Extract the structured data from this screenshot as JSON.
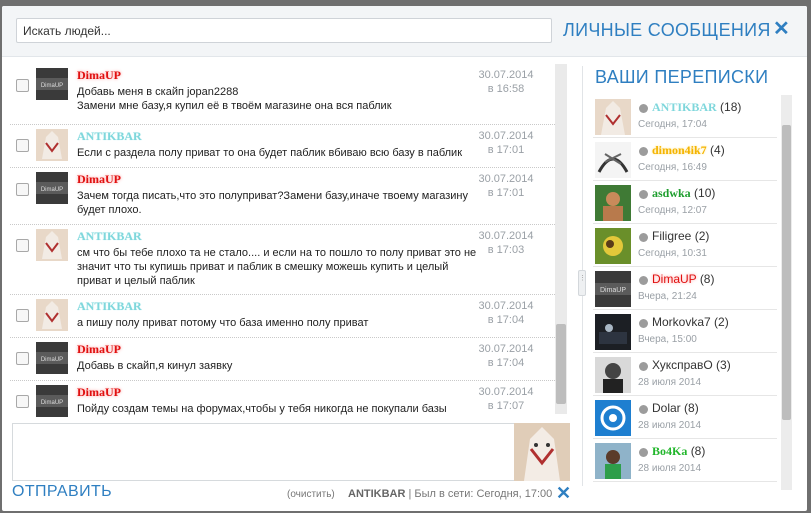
{
  "header": {
    "search_placeholder": "Искать людей...",
    "title": "ЛИЧНЫЕ СООБЩЕНИЯ",
    "close_glyph": "✕"
  },
  "messages": [
    {
      "nick": "DimaUP",
      "text": "Добавь меня в скайп jopan2288\nЗамени мне базу,я купил её в твоём магазине она вся паблик",
      "date": "30.07.2014",
      "time": "в 16:58"
    },
    {
      "nick": "ANTIKBAR",
      "text": "Если с раздела полу приват то она будет паблик вбиваю всю базу в паблик",
      "date": "30.07.2014",
      "time": "в 17:01"
    },
    {
      "nick": "DimaUP",
      "text": "Зачем тогда писать,что это полуприват?Замени базу,иначе твоему магазину будет плохо.",
      "date": "30.07.2014",
      "time": "в 17:01"
    },
    {
      "nick": "ANTIKBAR",
      "text": "см что бы тебе плохо та не стало.... и если на то пошло то полу приват это не значит что ты купишь приват и паблик в смешку можешь купить и целый приват и целый паблик",
      "date": "30.07.2014",
      "time": "в 17:03"
    },
    {
      "nick": "ANTIKBAR",
      "text": "а пишу полу приват потому что база именно полу приват",
      "date": "30.07.2014",
      "time": "в 17:04"
    },
    {
      "nick": "DimaUP",
      "text": "Добавь в скайп,я кинул заявку",
      "date": "30.07.2014",
      "time": "в 17:04"
    },
    {
      "nick": "DimaUP",
      "text": "Пойду создам темы на форумах,чтобы у тебя никогда не покупали базы",
      "date": "30.07.2014",
      "time": "в 17:07"
    }
  ],
  "composer": {
    "send_label": "ОТПРАВИТЬ",
    "clear_label": "(очистить)",
    "partner_name": "ANTIKBAR",
    "partner_status": " | Был в сети: Сегодня, 17:00",
    "close_glyph": "✕"
  },
  "conversations_title": "ВАШИ ПЕРЕПИСКИ",
  "conversations": [
    {
      "name": "ANTIKBAR",
      "count": "(18)",
      "when": "Сегодня, 17:04"
    },
    {
      "name": "dimon4ik7",
      "count": "(4)",
      "when": "Сегодня, 16:49"
    },
    {
      "name": "asdwka",
      "count": "(10)",
      "when": "Сегодня, 12:07"
    },
    {
      "name": "Filigree",
      "count": "(2)",
      "when": "Сегодня, 10:31"
    },
    {
      "name": "DimaUP",
      "count": "(8)",
      "when": "Вчера, 21:24"
    },
    {
      "name": "Morkovka7",
      "count": "(2)",
      "when": "Вчера, 15:00"
    },
    {
      "name": "ХуксправО",
      "count": "(3)",
      "when": "28 июля 2014"
    },
    {
      "name": "Dolar",
      "count": "(8)",
      "when": "28 июля 2014"
    },
    {
      "name": "Bo4Ka",
      "count": "(8)",
      "when": "28 июля 2014"
    }
  ],
  "colors": {
    "accent": "#2f7fc1",
    "dimaup": "#e01010",
    "antikbar": "#7fd7dc",
    "backdrop": "#6f6f6f"
  },
  "icons": {
    "close": "close-icon",
    "resize_handle": "drag-handle-icon"
  }
}
